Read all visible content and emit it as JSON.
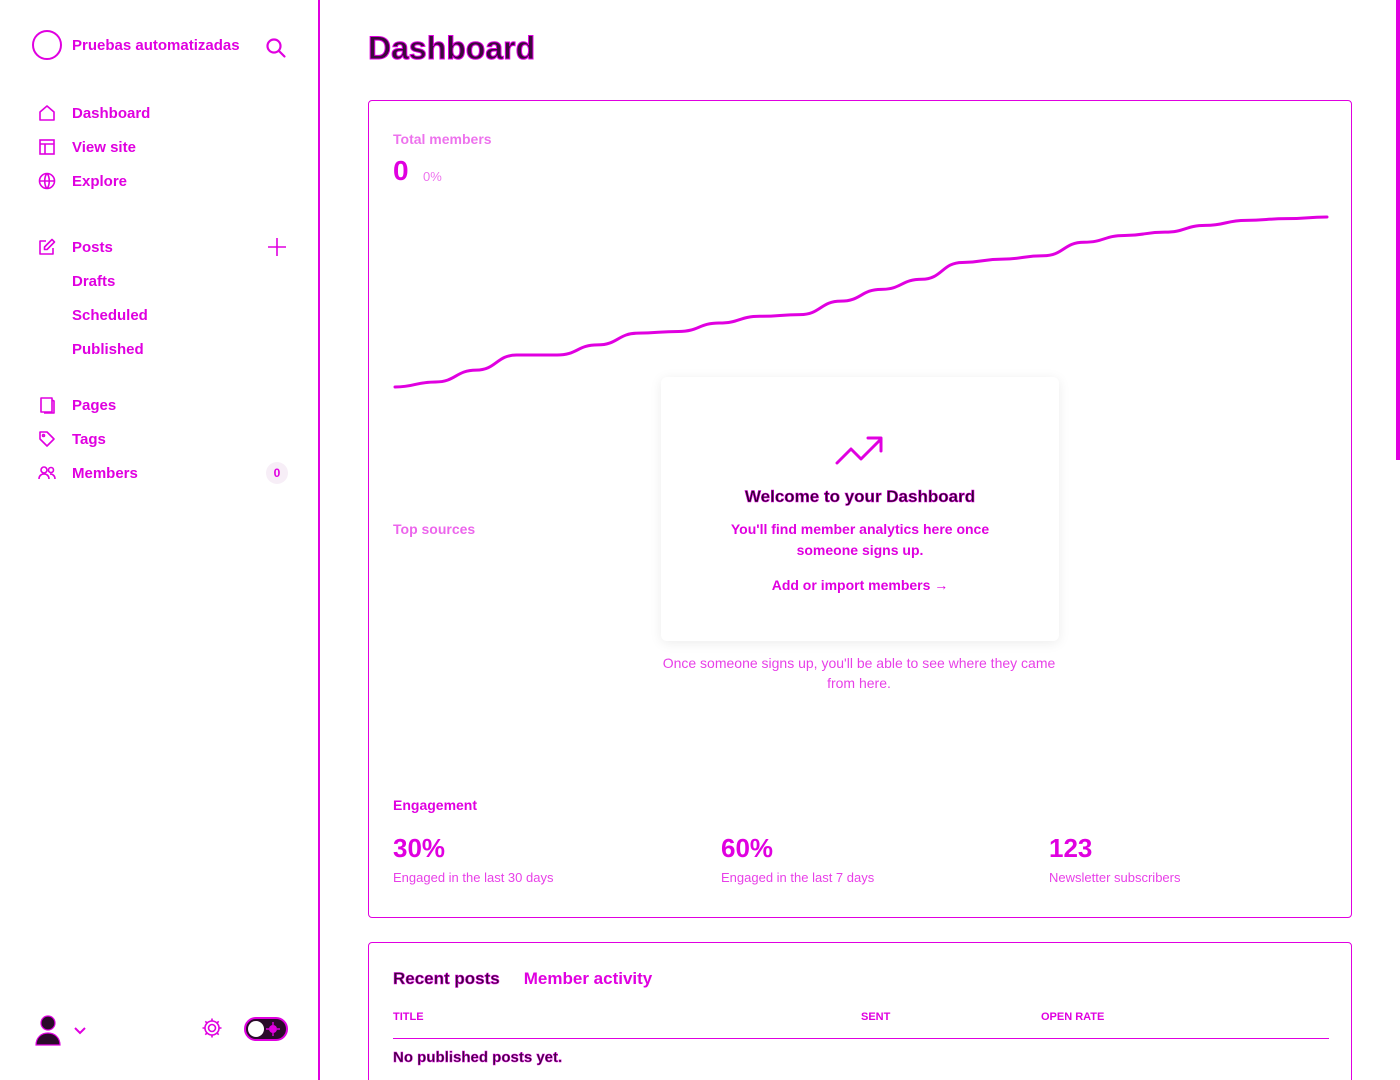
{
  "brand": {
    "name": "Pruebas automatizadas"
  },
  "nav": {
    "main": [
      {
        "label": "Dashboard",
        "icon": "home-icon"
      },
      {
        "label": "View site",
        "icon": "layout-icon"
      },
      {
        "label": "Explore",
        "icon": "globe-icon"
      }
    ],
    "posts": {
      "label": "Posts",
      "icon": "edit-icon"
    },
    "posts_sub": [
      "Drafts",
      "Scheduled",
      "Published"
    ],
    "more": [
      {
        "label": "Pages",
        "icon": "page-icon"
      },
      {
        "label": "Tags",
        "icon": "tag-icon"
      },
      {
        "label": "Members",
        "icon": "members-icon"
      }
    ],
    "members_badge": "0"
  },
  "main": {
    "title": "Dashboard",
    "total_members": {
      "label": "Total members",
      "value": "0",
      "change": "0%"
    },
    "top_sources": {
      "label": "Top sources",
      "empty_text": "Once someone signs up, you'll be able to see where they came from here."
    },
    "welcome": {
      "title": "Welcome to your Dashboard",
      "text": "You'll find member analytics here once someone signs up.",
      "link": "Add or import members →"
    },
    "engagement": {
      "label": "Engagement",
      "stats": [
        {
          "value": "30%",
          "desc": "Engaged in the last 30 days"
        },
        {
          "value": "60%",
          "desc": "Engaged in the last 7 days"
        },
        {
          "value": "123",
          "desc": "Newsletter subscribers"
        }
      ]
    },
    "recent": {
      "tabs": [
        "Recent posts",
        "Member activity"
      ],
      "columns": [
        "TITLE",
        "SENT",
        "OPEN RATE"
      ],
      "empty": "No published posts yet."
    }
  },
  "chart_data": {
    "type": "line",
    "title": "",
    "series": [
      {
        "values": [
          0,
          3,
          10,
          19,
          19,
          25,
          32,
          33,
          38,
          42,
          43,
          51,
          58,
          64,
          74,
          76,
          78,
          86,
          90,
          92,
          96,
          99,
          100,
          101
        ]
      }
    ],
    "ylim": [
      0,
      101
    ],
    "grid": false
  },
  "colors": {
    "accent": "#e000e0"
  }
}
